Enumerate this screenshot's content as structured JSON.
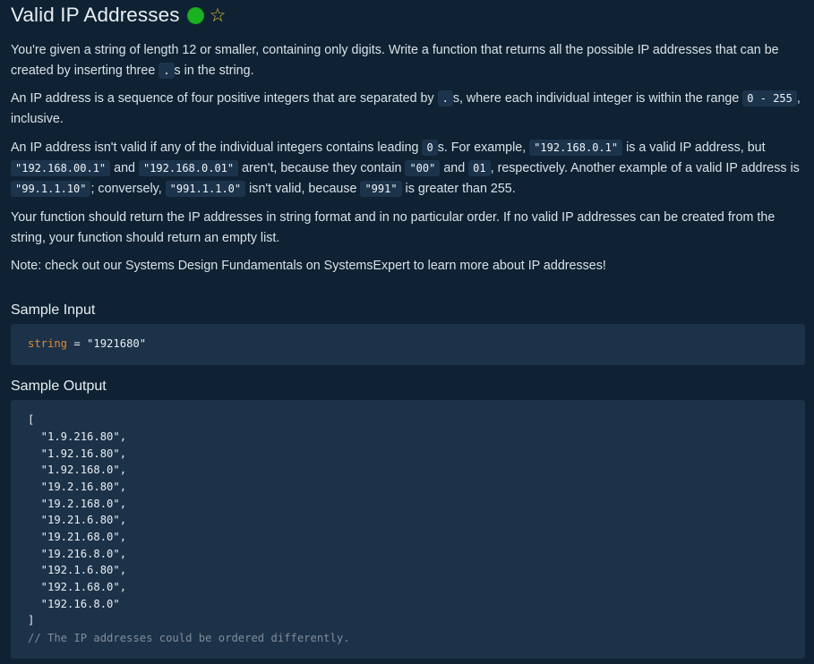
{
  "problem": {
    "title": "Valid IP Addresses",
    "status_icon": "green-dot-icon",
    "favorite_icon": "star-outline-icon",
    "paragraphs": {
      "p1": {
        "t1": "You're given a string of length 12 or smaller, containing only digits. Write a function that returns all the possible IP addresses that can be created by inserting three ",
        "c1": ".",
        "t2": "s in the string."
      },
      "p2": {
        "t1": "An IP address is a sequence of four positive integers that are separated by ",
        "c1": ".",
        "t2": "s, where each individual integer is within the range ",
        "c2": "0 - 255",
        "t3": ", inclusive."
      },
      "p3": {
        "t1": "An IP address isn't valid if any of the individual integers contains leading ",
        "c1": "0",
        "t2": "s. For example, ",
        "c2": "\"192.168.0.1\"",
        "t3": " is a valid IP address, but ",
        "c3": "\"192.168.00.1\"",
        "t4": " and ",
        "c4": "\"192.168.0.01\"",
        "t5": " aren't, because they contain ",
        "c5": "\"00\"",
        "t6": " and ",
        "c6": "01",
        "t7": ", respectively. Another example of a valid IP address is ",
        "c7": "\"99.1.1.10\"",
        "t8": "; conversely, ",
        "c8": "\"991.1.1.0\"",
        "t9": " isn't valid, because ",
        "c9": "\"991\"",
        "t10": " is greater than 255."
      },
      "p4": "Your function should return the IP addresses in string format and in no particular order. If no valid IP addresses can be created from the string, your function should return an empty list.",
      "p5": "Note: check out our Systems Design Fundamentals on SystemsExpert to learn more about IP addresses!"
    },
    "sample_input": {
      "heading": "Sample Input",
      "var_name": "string",
      "rest": " = \"1921680\""
    },
    "sample_output": {
      "heading": "Sample Output",
      "lines": [
        "[",
        "  \"1.9.216.80\",",
        "  \"1.92.16.80\",",
        "  \"1.92.168.0\",",
        "  \"19.2.16.80\",",
        "  \"19.2.168.0\",",
        "  \"19.21.6.80\",",
        "  \"19.21.68.0\",",
        "  \"19.216.8.0\",",
        "  \"192.1.6.80\",",
        "  \"192.1.68.0\",",
        "  \"192.16.8.0\"",
        "]"
      ],
      "comment": "// The IP addresses could be ordered differently."
    },
    "colors": {
      "background": "#0e2233",
      "code_background": "#1c3248",
      "keyword": "#e08a32",
      "status_green": "#1bb222",
      "star": "#e6b93a"
    }
  }
}
